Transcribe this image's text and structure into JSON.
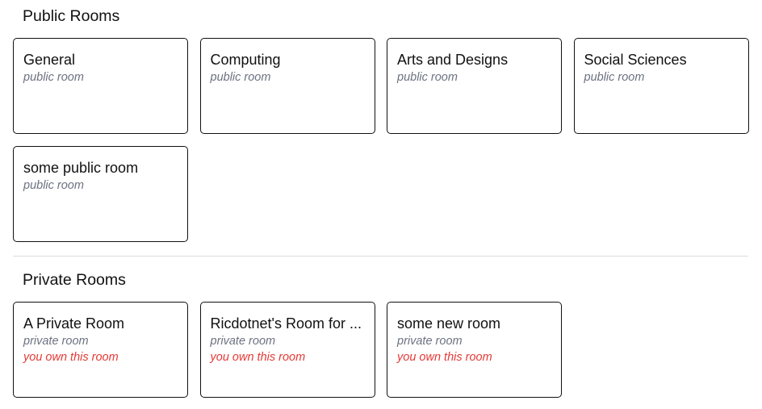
{
  "public": {
    "title": "Public Rooms",
    "rooms": [
      {
        "name": "General",
        "type": "public room"
      },
      {
        "name": "Computing",
        "type": "public room"
      },
      {
        "name": "Arts and Designs",
        "type": "public room"
      },
      {
        "name": "Social Sciences",
        "type": "public room"
      },
      {
        "name": "some public room",
        "type": "public room"
      }
    ]
  },
  "private": {
    "title": "Private Rooms",
    "rooms": [
      {
        "name": "A Private Room",
        "type": "private room",
        "owner_note": "you own this room"
      },
      {
        "name": "Ricdotnet's Room for ...",
        "type": "private room",
        "owner_note": "you own this room"
      },
      {
        "name": "some new room",
        "type": "private room",
        "owner_note": "you own this room"
      }
    ]
  },
  "colors": {
    "text": "#111111",
    "muted": "#6b7280",
    "owner_accent": "#e53935",
    "divider": "#dcdcdc"
  }
}
